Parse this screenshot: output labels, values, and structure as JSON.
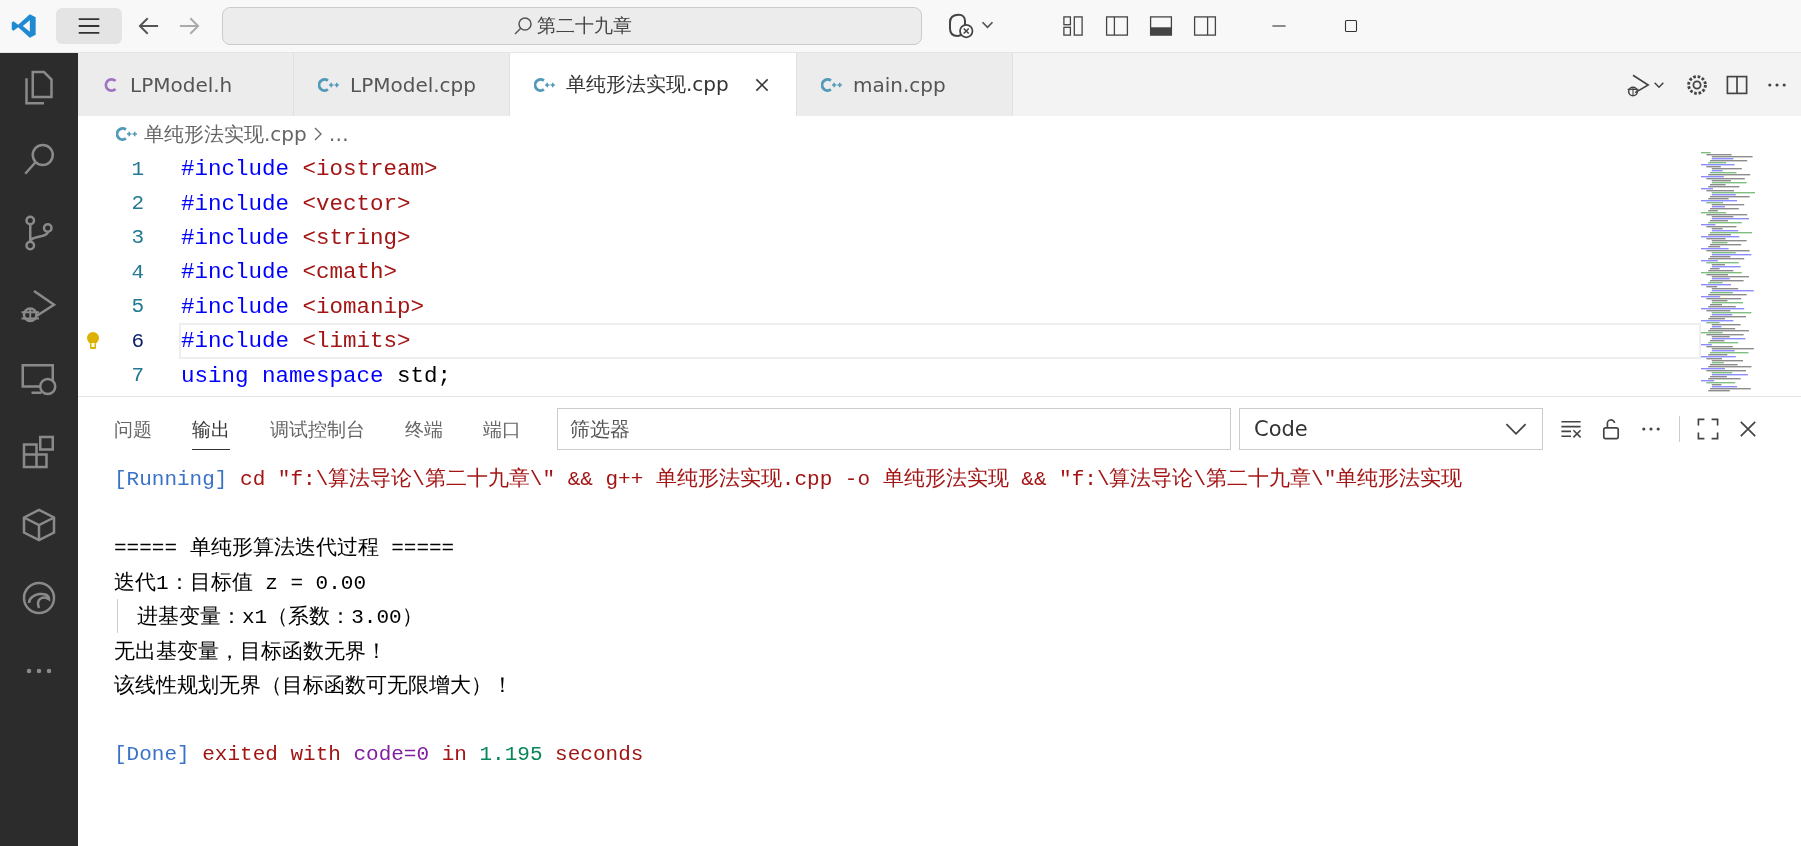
{
  "title_bar": {
    "search": "第二十九章"
  },
  "tabs": [
    {
      "label": "LPModel.h",
      "kind": "header",
      "selected": false
    },
    {
      "label": "LPModel.cpp",
      "kind": "source",
      "selected": false
    },
    {
      "label": "单纯形法实现.cpp",
      "kind": "source",
      "selected": true
    },
    {
      "label": "main.cpp",
      "kind": "source",
      "selected": false
    }
  ],
  "breadcrumb": {
    "file": "单纯形法实现.cpp",
    "more": "…"
  },
  "editor": {
    "lines": [
      {
        "number": "1",
        "current": false,
        "tokens": [
          {
            "kind": "keyword",
            "text": "#include"
          },
          {
            "kind": "string",
            "text": " <iostream>"
          }
        ]
      },
      {
        "number": "2",
        "current": false,
        "tokens": [
          {
            "kind": "keyword",
            "text": "#include"
          },
          {
            "kind": "string",
            "text": " <vector>"
          }
        ]
      },
      {
        "number": "3",
        "current": false,
        "tokens": [
          {
            "kind": "keyword",
            "text": "#include"
          },
          {
            "kind": "string",
            "text": " <string>"
          }
        ]
      },
      {
        "number": "4",
        "current": false,
        "tokens": [
          {
            "kind": "keyword",
            "text": "#include"
          },
          {
            "kind": "string",
            "text": " <cmath>"
          }
        ]
      },
      {
        "number": "5",
        "current": false,
        "tokens": [
          {
            "kind": "keyword",
            "text": "#include"
          },
          {
            "kind": "string",
            "text": " <iomanip>"
          }
        ]
      },
      {
        "number": "6",
        "current": true,
        "tokens": [
          {
            "kind": "keyword",
            "text": "#include"
          },
          {
            "kind": "string",
            "text": " <limits>"
          }
        ]
      },
      {
        "number": "7",
        "current": false,
        "tokens": [
          {
            "kind": "keyword",
            "text": "using"
          },
          {
            "kind": "keyword",
            "text": " namespace"
          },
          {
            "kind": "plain",
            "text": " std;"
          }
        ]
      }
    ]
  },
  "panel": {
    "tabs": [
      {
        "label": "问题",
        "selected": false
      },
      {
        "label": "输出",
        "selected": true
      },
      {
        "label": "调试控制台",
        "selected": false
      },
      {
        "label": "终端",
        "selected": false
      },
      {
        "label": "端口",
        "selected": false
      }
    ],
    "filter": {
      "placeholder": "筛选器"
    },
    "channel": "Code",
    "output": [
      {
        "kind": "text",
        "tokens": [
          {
            "kind": "info",
            "text": "[Running]"
          },
          {
            "kind": "red",
            "text": " cd \"f:\\算法导论\\第二十九章\\\" && g++ 单纯形法实现.cpp -o 单纯形法实现 && \"f:\\算法导论\\第二十九章\\\"单纯形法实现"
          }
        ]
      },
      {
        "kind": "blank"
      },
      {
        "kind": "text",
        "tokens": [
          {
            "kind": "plain",
            "text": "===== 单纯形算法迭代过程 ====="
          }
        ]
      },
      {
        "kind": "text",
        "tokens": [
          {
            "kind": "plain",
            "text": "迭代1：目标值 z = 0.00"
          }
        ]
      },
      {
        "kind": "indented",
        "tokens": [
          {
            "kind": "plain",
            "text": "进基变量：x1（系数：3.00）"
          }
        ]
      },
      {
        "kind": "text",
        "tokens": [
          {
            "kind": "plain",
            "text": "无出基变量，目标函数无界！"
          }
        ]
      },
      {
        "kind": "text",
        "tokens": [
          {
            "kind": "plain",
            "text": "该线性规划无界（目标函数可无限增大）！"
          }
        ]
      },
      {
        "kind": "blank"
      },
      {
        "kind": "text",
        "tokens": [
          {
            "kind": "info",
            "text": "[Done]"
          },
          {
            "kind": "red",
            "text": " exited with "
          },
          {
            "kind": "purple",
            "text": "code=0"
          },
          {
            "kind": "red",
            "text": " in "
          },
          {
            "kind": "green",
            "text": "1.195"
          },
          {
            "kind": "red",
            "text": " seconds"
          }
        ]
      }
    ]
  }
}
